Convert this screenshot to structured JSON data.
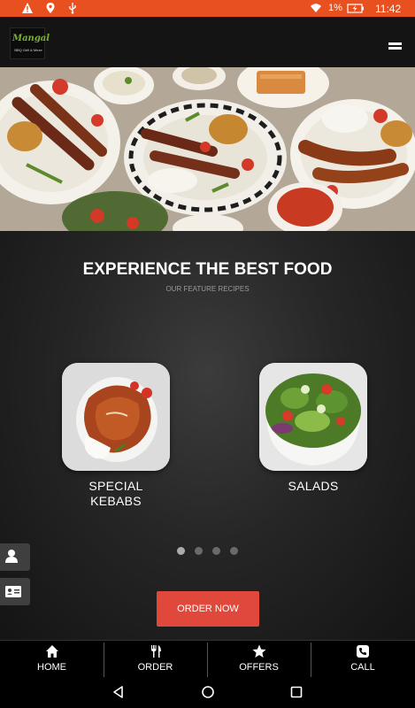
{
  "status_bar": {
    "battery_percent": "1%",
    "time": "11:42",
    "color": "#e8501f",
    "icons": [
      "warning-icon",
      "location-pin-icon",
      "usb-icon",
      "wifi-icon",
      "battery-charging-icon"
    ]
  },
  "header": {
    "logo_script": "Mangal",
    "logo_tagline": "BBQ Grill & Meze",
    "menu_icon": "hamburger-menu-icon"
  },
  "featured": {
    "title": "EXPERIENCE THE BEST FOOD",
    "subtitle": "OUR FEATURE RECIPES",
    "items": [
      {
        "label_line1": "SPECIAL",
        "label_line2": "KEBABS"
      },
      {
        "label_line1": "SALADS",
        "label_line2": ""
      }
    ],
    "carousel_pages": 4,
    "carousel_active_page": 1
  },
  "side_buttons": [
    "user-icon",
    "contact-card-icon"
  ],
  "order_button": {
    "label": "ORDER NOW",
    "color": "#e0483b"
  },
  "bottom_nav": {
    "items": [
      {
        "label": "HOME",
        "icon": "home-icon"
      },
      {
        "label": "ORDER",
        "icon": "fork-knife-icon"
      },
      {
        "label": "OFFERS",
        "icon": "star-icon"
      },
      {
        "label": "CALL",
        "icon": "phone-icon"
      }
    ]
  },
  "system_nav": [
    "back-icon",
    "home-circle-icon",
    "recents-icon"
  ]
}
